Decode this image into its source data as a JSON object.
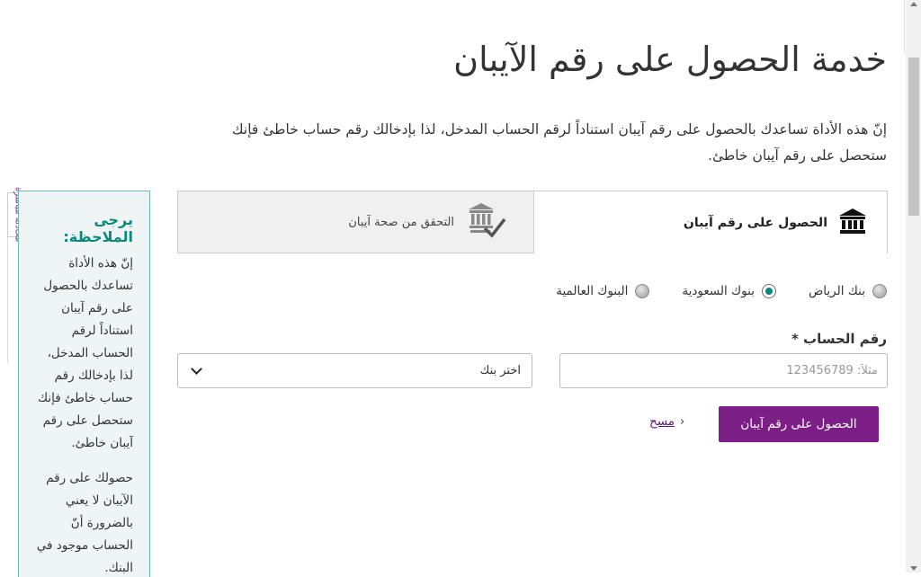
{
  "page": {
    "title": "خدمة الحصول على رقم الآيبان",
    "intro": "إنّ هذه الأداة تساعدك بالحصول على رقم آيبان استناداً لرقم الحساب المدخل، لذا بإدخالك رقم حساب خاطئ فإنك ستحصل على رقم آيبان خاطئ."
  },
  "note": {
    "title": "يرجى الملاحظة:",
    "paragraph1": "إنّ هذه الأداة تساعدك بالحصول على رقم آيبان استناداً لرقم الحساب المدخل، لذا بإدخالك رقم حساب خاطئ فإنك ستحصل على رقم آيبان خاطئ.",
    "paragraph2": "حصولك على رقم الآيبان لا يعني بالضرورة أنّ الحساب موجود في البنك."
  },
  "chat_tab": {
    "label": "محادثة مباشرة"
  },
  "tabs": [
    {
      "label": "الحصول على رقم آيبان",
      "icon": "bank-icon",
      "active": true
    },
    {
      "label": "التحقق من صحة آيبان",
      "icon": "bank-check-icon",
      "active": false
    }
  ],
  "radios": [
    {
      "label": "بنك الرياض",
      "checked": false
    },
    {
      "label": "بنوك السعودية",
      "checked": true
    },
    {
      "label": "البنوك العالمية",
      "checked": false
    }
  ],
  "form": {
    "account_label": "رقم الحساب *",
    "account_placeholder": "مثلاً: 123456789",
    "bank_select_value": "اختر بنك",
    "submit_label": "الحصول على رقم آيبان",
    "clear_label": "مسح"
  },
  "colors": {
    "accent_purple": "#7b1f86",
    "note_teal": "#0b8a7c"
  }
}
